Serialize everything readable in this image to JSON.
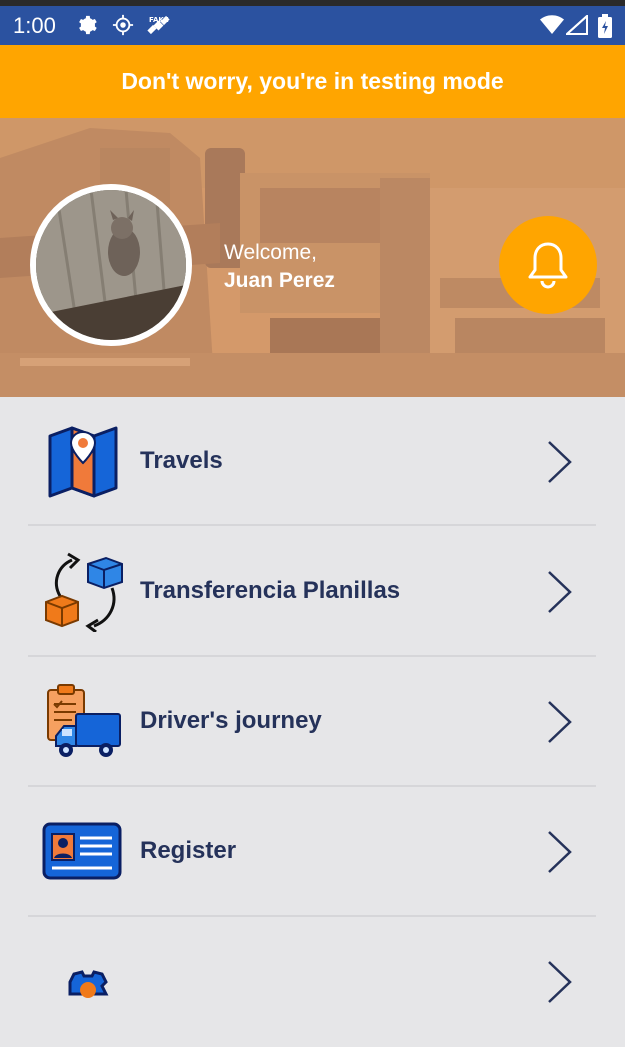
{
  "status_bar": {
    "time": "1:00",
    "left_icons": [
      "gear-icon",
      "location-target-icon",
      "satellite-icon"
    ],
    "right_icons": [
      "wifi-icon",
      "signal-icon",
      "battery-icon"
    ]
  },
  "banner": {
    "text": "Don't worry, you're in testing mode",
    "color": "#ffa500"
  },
  "header": {
    "greeting": "Welcome,",
    "user_name": "Juan Perez",
    "notification_button": "bell-icon"
  },
  "menu": {
    "items": [
      {
        "label": "Travels",
        "icon": "map-pin-icon"
      },
      {
        "label": "Transferencia Planillas",
        "icon": "box-transfer-icon"
      },
      {
        "label": "Driver's journey",
        "icon": "clipboard-truck-icon"
      },
      {
        "label": "Register",
        "icon": "id-card-icon"
      },
      {
        "label": "",
        "icon": "settings-gear-icon"
      }
    ]
  },
  "colors": {
    "primary": "#2b52a0",
    "accent": "#ffa500",
    "text_dark": "#25325a",
    "background": "#e6e6e8"
  }
}
